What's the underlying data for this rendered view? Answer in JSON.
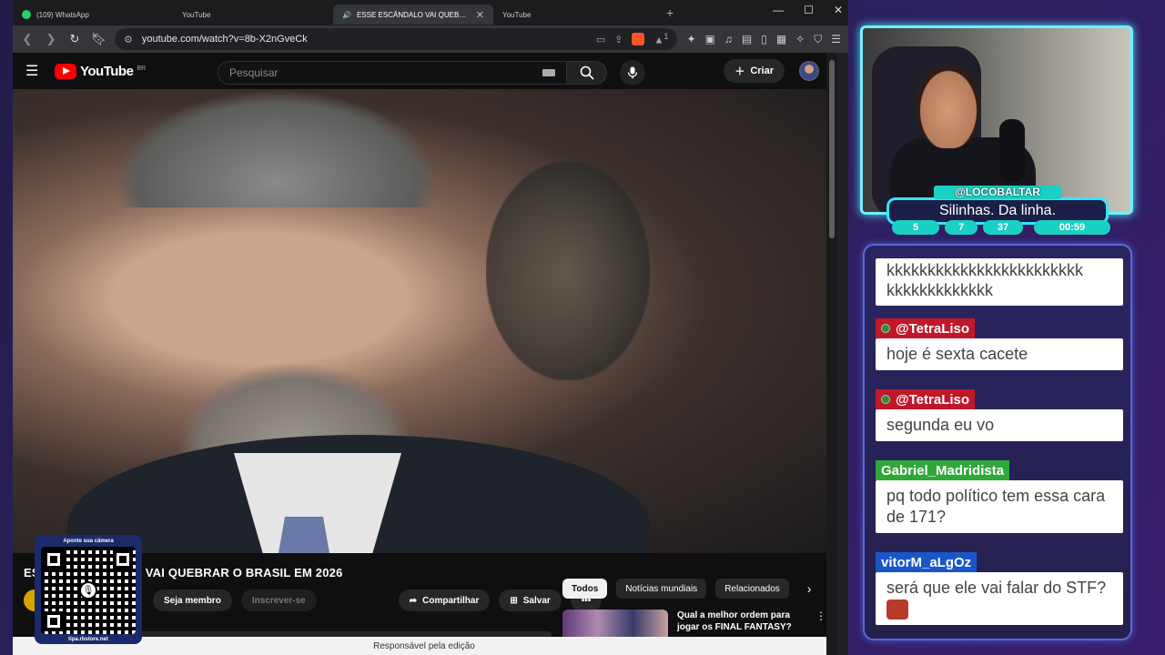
{
  "browser": {
    "tabs": [
      {
        "title": "(109) WhatsApp",
        "favicon": "whatsapp-icon",
        "active": false
      },
      {
        "title": "YouTube",
        "favicon": "youtube-icon",
        "active": false
      },
      {
        "title": "ESSE ESCÂNDALO VAI QUEBRAR O",
        "favicon": "youtube-icon",
        "active": true
      },
      {
        "title": "YouTube",
        "favicon": "youtube-icon",
        "active": false
      }
    ],
    "url": "youtube.com/watch?v=8b-X2nGveCk",
    "shield_badge": "1"
  },
  "youtube": {
    "logo_text": "YouTube",
    "country_code": "BR",
    "search_placeholder": "Pesquisar",
    "create_label": "Criar",
    "video_title_prefix": "ES",
    "video_title_suffix": "VAI QUEBRAR O BRASIL EM 2026",
    "join_label": "Seja membro",
    "subscribe_label": "Inscrever-se",
    "share_label": "Compartilhar",
    "save_label": "Salvar",
    "more_label": "•••",
    "chips": [
      "Todos",
      "Notícias mundiais",
      "Relacionados"
    ],
    "recommended": {
      "title": "Qual a melhor ordem para jogar os FINAL FANTASY?"
    },
    "status_text": "Responsável pela edição"
  },
  "qr_overlay": {
    "caption": "Aponte sua câmera",
    "footer": "tipa.rbstore.net"
  },
  "webcam": {
    "handle": "@LOCOBALTAR",
    "message": "Silinhas. Da linha.",
    "stats": [
      "5",
      "7",
      "37",
      "00:59"
    ]
  },
  "chat": {
    "messages": [
      {
        "user": "",
        "text": "kkkkkkkkkkkkkkkkkkkkkkkk kkkkkkkkkkkkk"
      },
      {
        "user": "@TetraLiso",
        "text": "hoje é sexta cacete",
        "color": "#c0182a"
      },
      {
        "user": "@TetraLiso",
        "text": "segunda eu vo",
        "color": "#c0182a"
      },
      {
        "user": "Gabriel_Madridista",
        "text": "pq todo político tem essa cara de 171?",
        "color": "#2fa83a"
      },
      {
        "user": "vitorM_aLgOz",
        "text": "será que ele vai falar do STF?",
        "color": "#1a56c8"
      }
    ]
  }
}
